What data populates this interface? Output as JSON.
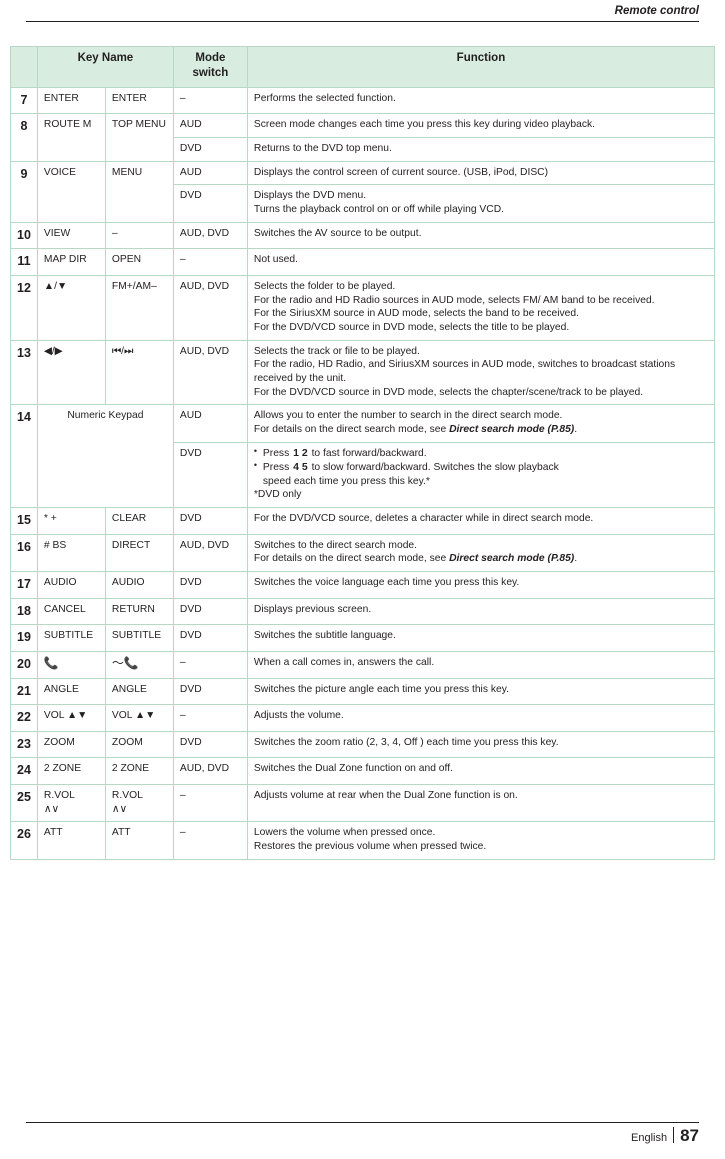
{
  "header": {
    "title": "Remote control"
  },
  "footer": {
    "language": "English",
    "page": "87"
  },
  "table": {
    "columns": [
      "",
      "Key Name",
      "Mode switch",
      "Function"
    ],
    "rows": [
      {
        "num": "7",
        "key1": "ENTER",
        "key2": "ENTER",
        "sub": [
          {
            "mode": "–",
            "fn": "Performs the selected function."
          }
        ]
      },
      {
        "num": "8",
        "key1": "ROUTE M",
        "key2": "TOP MENU",
        "sub": [
          {
            "mode": "AUD",
            "fn": "Screen mode changes each time you press this key during video playback."
          },
          {
            "mode": "DVD",
            "fn": "Returns to the DVD top menu."
          }
        ]
      },
      {
        "num": "9",
        "key1": "VOICE",
        "key2": "MENU",
        "sub": [
          {
            "mode": "AUD",
            "fn": "Displays the control screen of current source. (USB, iPod, DISC)"
          },
          {
            "mode": "DVD",
            "fn": "Displays the DVD menu.\nTurns the playback control on or off while playing VCD."
          }
        ]
      },
      {
        "num": "10",
        "key1": "VIEW",
        "key2": "–",
        "sub": [
          {
            "mode": "AUD, DVD",
            "fn": "Switches the AV source to be output."
          }
        ]
      },
      {
        "num": "11",
        "key1": "MAP DIR",
        "key2": "OPEN",
        "sub": [
          {
            "mode": "–",
            "fn": "Not used."
          }
        ]
      },
      {
        "num": "12",
        "key1": "▲/▼",
        "key2": "FM+/AM–",
        "sub": [
          {
            "mode": "AUD, DVD",
            "fn": "Selects the folder to be played.\nFor the radio and HD Radio sources in AUD mode, selects FM/ AM band to be received.\nFor the SiriusXM source in AUD mode, selects the band to be received.\nFor the DVD/VCD source in DVD mode, selects the title to be played."
          }
        ]
      },
      {
        "num": "13",
        "key1": "◀/▶",
        "key2": "⏮/⏭",
        "sub": [
          {
            "mode": "AUD, DVD",
            "fn": "Selects the track or file to be played.\nFor the radio, HD Radio, and SiriusXM sources in AUD mode, switches to broadcast stations received by the unit.\nFor the DVD/VCD source in DVD mode, selects the chapter/scene/track to be played."
          }
        ]
      },
      {
        "num": "14",
        "key1": "Numeric Keypad",
        "key2": null,
        "keypad_span": true,
        "sub": [
          {
            "mode": "AUD",
            "fn": "Allows you to enter the number to search in the direct search mode.\nFor details on the direct search mode, see ",
            "bold_tail": "Direct search mode (P.85)",
            "tail": "."
          },
          {
            "mode": "DVD",
            "bullets": [
              {
                "pre": "Press ",
                "keys": "1  2",
                "post": " to fast forward/backward."
              },
              {
                "pre": "Press ",
                "keys": "4  5",
                "post": " to slow forward/backward. Switches the slow playback"
              },
              {
                "cont": "speed each time you press this key.*"
              }
            ],
            "note": "*DVD only"
          }
        ]
      },
      {
        "num": "15",
        "key1": "* +",
        "key2": "CLEAR",
        "sub": [
          {
            "mode": "DVD",
            "fn": "For the DVD/VCD source, deletes a character while in direct search mode."
          }
        ]
      },
      {
        "num": "16",
        "key1": "# BS",
        "key2": "DIRECT",
        "sub": [
          {
            "mode": "AUD, DVD",
            "fn": "Switches to the direct search mode.\nFor details on the direct search mode, see ",
            "bold_tail": "Direct search mode (P.85)",
            "tail": "."
          }
        ]
      },
      {
        "num": "17",
        "key1": "AUDIO",
        "key2": "AUDIO",
        "sub": [
          {
            "mode": "DVD",
            "fn": "Switches the voice language each time you press this key."
          }
        ]
      },
      {
        "num": "18",
        "key1": "CANCEL",
        "key2": "RETURN",
        "sub": [
          {
            "mode": "DVD",
            "fn": "Displays previous screen."
          }
        ]
      },
      {
        "num": "19",
        "key1": "SUBTITLE",
        "key2": "SUBTITLE",
        "sub": [
          {
            "mode": "DVD",
            "fn": "Switches the subtitle language."
          }
        ]
      },
      {
        "num": "20",
        "key1": "📞",
        "key2": "〜📞",
        "icon_row": true,
        "sub": [
          {
            "mode": "–",
            "fn": "When a call comes in, answers the call."
          }
        ]
      },
      {
        "num": "21",
        "key1": "ANGLE",
        "key2": "ANGLE",
        "sub": [
          {
            "mode": "DVD",
            "fn": "Switches the picture angle each time you press this key."
          }
        ]
      },
      {
        "num": "22",
        "key1": "VOL ▲▼",
        "key2": "VOL ▲▼",
        "sub": [
          {
            "mode": "–",
            "fn": "Adjusts the volume."
          }
        ]
      },
      {
        "num": "23",
        "key1": "ZOOM",
        "key2": "ZOOM",
        "sub": [
          {
            "mode": "DVD",
            "fn": "Switches the zoom ratio (2, 3, 4, Off ) each time you press this key."
          }
        ]
      },
      {
        "num": "24",
        "key1": "2 ZONE",
        "key2": "2 ZONE",
        "sub": [
          {
            "mode": "AUD, DVD",
            "fn": "Switches the Dual Zone function on and off."
          }
        ]
      },
      {
        "num": "25",
        "key1": "R.VOL\n∧∨",
        "key2": "R.VOL\n∧∨",
        "sub": [
          {
            "mode": "–",
            "fn": "Adjusts volume at rear when the Dual Zone function is on."
          }
        ]
      },
      {
        "num": "26",
        "key1": "ATT",
        "key2": "ATT",
        "sub": [
          {
            "mode": "–",
            "fn": "Lowers the volume when pressed once.\nRestores the previous volume when pressed twice."
          }
        ]
      }
    ]
  }
}
